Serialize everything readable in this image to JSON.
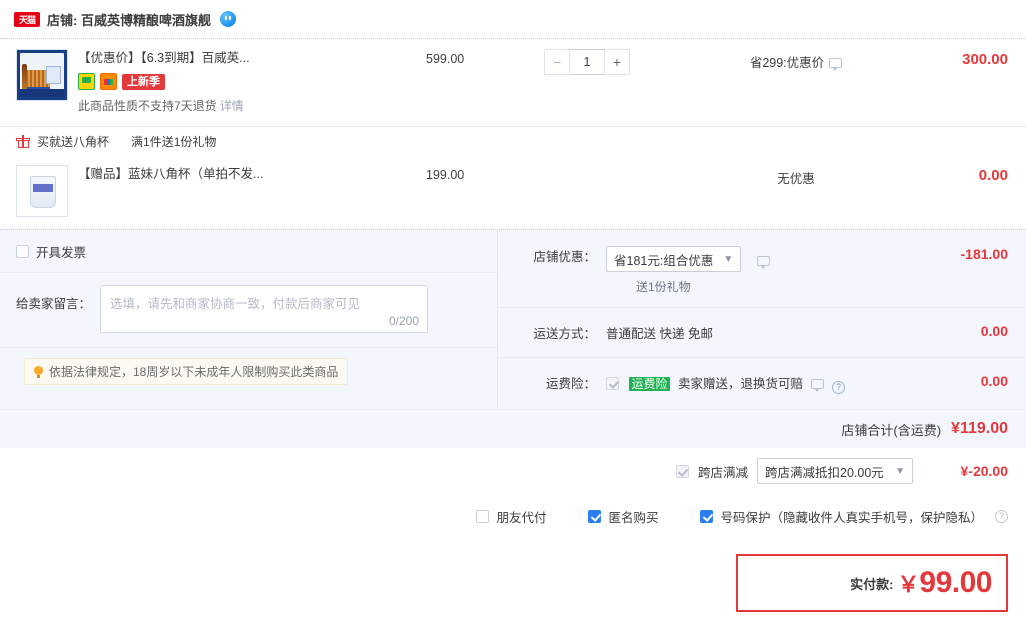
{
  "shop": {
    "badge": "天猫",
    "label": "店铺: 百威英博精酿啤酒旗舰",
    "chat_icon": "wangwang-icon"
  },
  "items": [
    {
      "title": "【优惠价】【6.3到期】百威英...",
      "tag": "上新季",
      "return_note": "此商品性质不支持7天退货",
      "return_link": "详情",
      "price": "599.00",
      "qty": "1",
      "minus": "−",
      "plus": "+",
      "promo": "省299:优惠价",
      "subtotal": "300.00"
    }
  ],
  "gift": {
    "bar_title": "买就送八角杯",
    "bar_rule": "满1件送1份礼物",
    "title": "【赠品】蓝妹八角杯（单拍不发...",
    "price": "199.00",
    "promo": "无优惠",
    "subtotal": "0.00"
  },
  "invoice": {
    "label": "开具发票",
    "checked": false
  },
  "message": {
    "label": "给卖家留言：",
    "placeholder": "选填，请先和商家协商一致，付款后商家可见",
    "value": "",
    "counter": "0/200"
  },
  "notice": {
    "text": "依据法律规定，18周岁以下未成年人限制购买此类商品"
  },
  "shop_discount": {
    "label": "店铺优惠：",
    "selected": "省181元:组合优惠",
    "sub_note": "送1份礼物",
    "amount": "-181.00"
  },
  "shipping": {
    "label": "运送方式：",
    "value": "普通配送 快递 免邮",
    "amount": "0.00"
  },
  "insurance": {
    "label": "运费险：",
    "badge": "运费险",
    "text": "卖家赠送，退换货可赔",
    "amount": "0.00",
    "checked": true
  },
  "shop_total": {
    "label": "店铺合计(含运费)",
    "amount": "¥119.00"
  },
  "cross_store": {
    "label": "跨店满减",
    "selected": "跨店满减抵扣20.00元",
    "amount": "¥-20.00",
    "checked": true
  },
  "bottom_options": [
    {
      "label": "朋友代付",
      "checked": false
    },
    {
      "label": "匿名购买",
      "checked": true
    },
    {
      "label": "号码保护（隐藏收件人真实手机号，保护隐私）",
      "checked": true
    }
  ],
  "pay": {
    "label": "实付款:",
    "currency": "￥",
    "amount": "99.00"
  },
  "colors": {
    "accent_red": "#e4393c",
    "panel_bg": "#f3f6fd",
    "checkbox_blue": "#2a7ff3",
    "insurance_green": "#20b253"
  }
}
